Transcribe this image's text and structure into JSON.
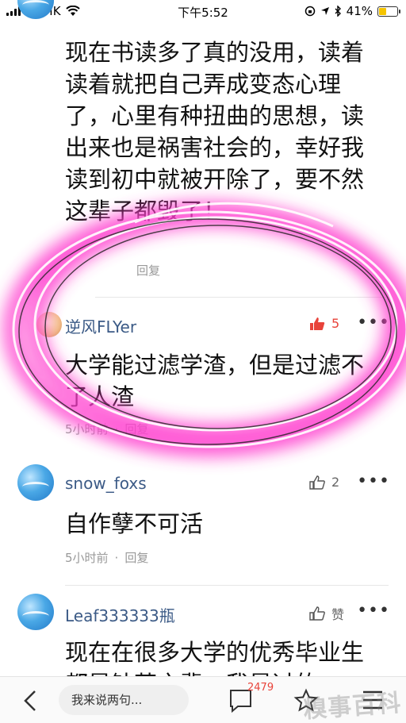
{
  "status_bar": {
    "carrier": "CMHK",
    "time": "下午5:52",
    "battery": "41%"
  },
  "comments": [
    {
      "text": "现在书读多了真的没用，读着读着就把自己弄成变态心理了，心里有种扭曲的思想，读出来也是祸害社会的，幸好我读到初中就被开除了，要不然这辈子都毁了！",
      "reply": "回复"
    },
    {
      "username": "逆风FLYer",
      "likes": "5",
      "text": "大学能过滤学渣，但是过滤不了人渣",
      "time": "5小时前",
      "reply": "回复"
    },
    {
      "username": "snow_foxs",
      "likes": "2",
      "text": "自作孽不可活",
      "time": "5小时前",
      "reply": "回复"
    },
    {
      "username": "Leaf333333瓶",
      "likes": "赞",
      "text": "现在在很多大学的优秀毕业生都是钻营之辈，我是过的"
    }
  ],
  "bottom_bar": {
    "reply_placeholder": "我来说两句...",
    "comment_count": "2479"
  },
  "watermark": "糗事百科",
  "colors": {
    "like_active": "#e8433a",
    "username": "#3b5a86",
    "highlight": "#ff3fcf"
  },
  "icons": [
    "wifi-icon",
    "lock-rotation-icon",
    "location-icon",
    "bluetooth-icon",
    "thumb-up-icon",
    "more-icon",
    "back-icon",
    "comment-icon",
    "star-icon",
    "menu-icon"
  ]
}
